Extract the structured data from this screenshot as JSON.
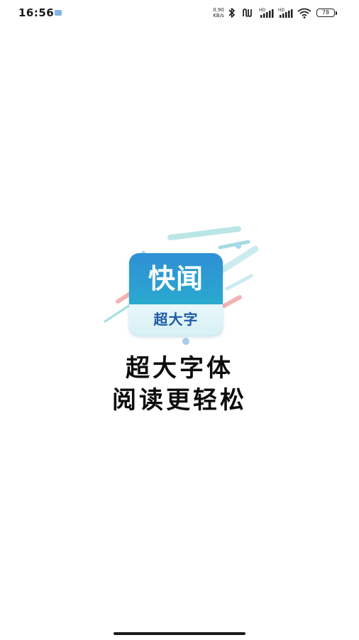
{
  "status_bar": {
    "time": "16:56",
    "net_speed_value": "0.90",
    "net_speed_unit": "KB/s",
    "signal_1_label": "HD",
    "signal_2_label": "HD",
    "battery_level": "78",
    "icons": [
      "notification-icon",
      "bluetooth-icon",
      "nfc-icon",
      "signal-icon",
      "signal-icon",
      "wifi-icon",
      "battery-icon"
    ]
  },
  "splash": {
    "logo_title": "快闻",
    "logo_subtitle": "超大字",
    "tagline_line1": "超大字体",
    "tagline_line2": "阅读更轻松"
  },
  "colors": {
    "logo_gradient_top": "#2f8fd6",
    "logo_gradient_bottom": "#36c2c3",
    "logo_subtitle": "#1f5aa6",
    "accent_red": "#f3a7a7",
    "accent_teal": "#7fd6d8",
    "background": "#ffffff"
  }
}
